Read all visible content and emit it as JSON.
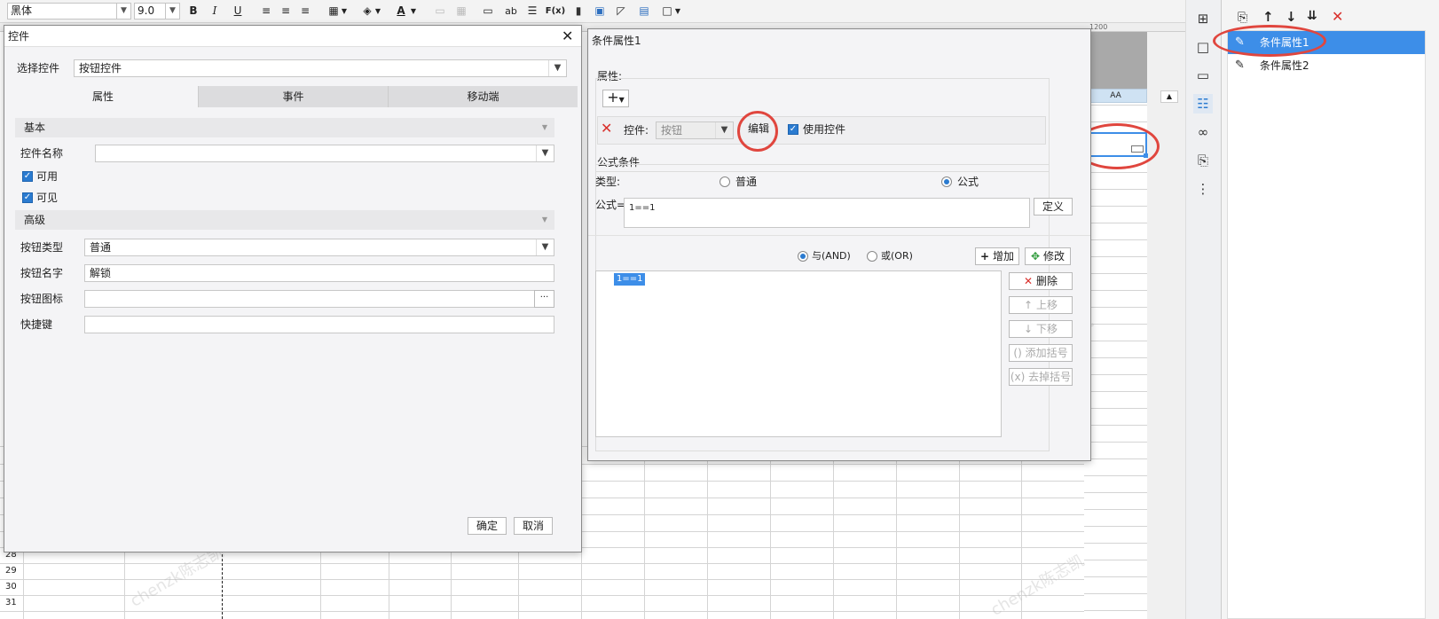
{
  "toolbar": {
    "font_name": "黑体",
    "font_size": "9.0",
    "bold": "B",
    "italic": "I",
    "underline": "U",
    "text_icon": "ab",
    "fx_icon": "F(x)"
  },
  "ruler": {
    "mark": "1200"
  },
  "sheet": {
    "column_header": "AA",
    "rows": [
      "28",
      "29",
      "30",
      "31"
    ]
  },
  "control_dialog": {
    "title": "控件",
    "select_label": "选择控件",
    "select_value": "按钮控件",
    "tabs": [
      {
        "label": "属性"
      },
      {
        "label": "事件"
      },
      {
        "label": "移动端"
      }
    ],
    "basic_section": "基本",
    "control_name_label": "控件名称",
    "control_name_value": "",
    "enabled_label": "可用",
    "visible_label": "可见",
    "advanced_section": "高级",
    "button_type_label": "按钮类型",
    "button_type_value": "普通",
    "button_name_label": "按钮名字",
    "button_name_value": "解锁",
    "button_icon_label": "按钮图标",
    "button_icon_value": "",
    "browse_label": "···",
    "shortcut_label": "快捷键",
    "shortcut_value": "",
    "ok_label": "确定",
    "cancel_label": "取消"
  },
  "condition_dialog": {
    "title": "条件属性1",
    "attr_label": "属性:",
    "add_icon": "+",
    "control_label": "控件:",
    "control_value": "按钮",
    "edit_label": "编辑",
    "use_control_label": "使用控件",
    "formula_condition_label": "公式条件",
    "type_label": "类型:",
    "radio_normal": "普通",
    "radio_formula": "公式",
    "formula_label": "公式=",
    "formula_value": "1==1",
    "define_label": "定义",
    "and_label": "与(AND)",
    "or_label": "或(OR)",
    "add_label": "增加",
    "modify_label": "修改",
    "condition_item": "1==1",
    "delete_label": "删除",
    "move_up_label": "上移",
    "move_down_label": "下移",
    "add_bracket_label": "添加括号",
    "remove_bracket_label": "去掉括号"
  },
  "right_panel": {
    "items": [
      {
        "label": "条件属性1",
        "selected": true
      },
      {
        "label": "条件属性2",
        "selected": false
      }
    ]
  },
  "watermark": {
    "text": "chenzk陈志凯"
  },
  "colors": {
    "selection": "#3d8ee8",
    "annotation_circle": "#e0463e",
    "delete_red": "#d9302c"
  }
}
